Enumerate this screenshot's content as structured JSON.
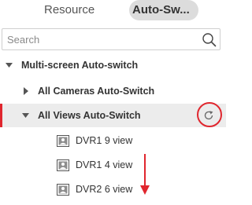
{
  "tabs": [
    {
      "label": "Resource",
      "active": false
    },
    {
      "label": "Auto-Sw...",
      "active": true
    }
  ],
  "search": {
    "placeholder": "Search",
    "value": "",
    "icon": "search-icon"
  },
  "tree": {
    "root": {
      "label": "Multi-screen Auto-switch",
      "expanded": true
    },
    "groups": [
      {
        "label": "All Cameras Auto-Switch",
        "expanded": false
      },
      {
        "label": "All Views Auto-Switch",
        "expanded": true,
        "selected": true,
        "action_icon": "refresh-icon"
      }
    ],
    "views": [
      {
        "label": "DVR1 9 view",
        "icon": "view-icon"
      },
      {
        "label": "DVR1 4 view",
        "icon": "view-icon"
      },
      {
        "label": "DVR2 6 view",
        "icon": "view-icon"
      }
    ]
  },
  "colors": {
    "accent": "#e0262e",
    "selected_row": "#ececec",
    "active_tab": "#dcdcdc",
    "text": "#333333"
  }
}
